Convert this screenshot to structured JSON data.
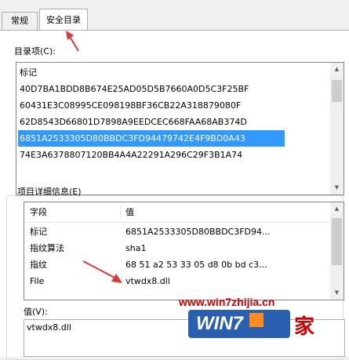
{
  "tabs": {
    "general": "常规",
    "security_catalog": "安全目录"
  },
  "catalog": {
    "label": "目录项(C):",
    "header": "标记",
    "items": [
      "40D7BA1BDD8B674E25AD05D5B7660A0D5C3F25BF",
      "60431E3C08995CE098198BF36CB22A318879080F",
      "62D8543D66801D7898A9EEDCEC668FAA68AB374D",
      "6851A2533305D80BBDC3FD94479742E4F9BD0A43",
      "74E3A6378807120BB4A4A22291A296C29F3B1A74"
    ],
    "selected_index": 3
  },
  "details": {
    "label": "项目详细信息(E)",
    "col_field": "字段",
    "col_value": "值",
    "rows": [
      {
        "field": "标记",
        "value": "6851A2533305D80BBDC3FD94..."
      },
      {
        "field": "指纹算法",
        "value": "sha1"
      },
      {
        "field": "指纹",
        "value": "68 51 a2 53 33 05 d8 0b bd c3..."
      },
      {
        "field": "File",
        "value": "vtwdx8.dll"
      }
    ]
  },
  "value_box": {
    "label": "值(V):",
    "text": "vtwdx8.dll"
  },
  "watermark": {
    "url": "www.win7zhijia.cn",
    "brand": "WIN7",
    "suffix": "家"
  },
  "colors": {
    "selection": "#3399ff",
    "annotation_arrow": "#d9383a",
    "watermark_red": "#c80000"
  }
}
